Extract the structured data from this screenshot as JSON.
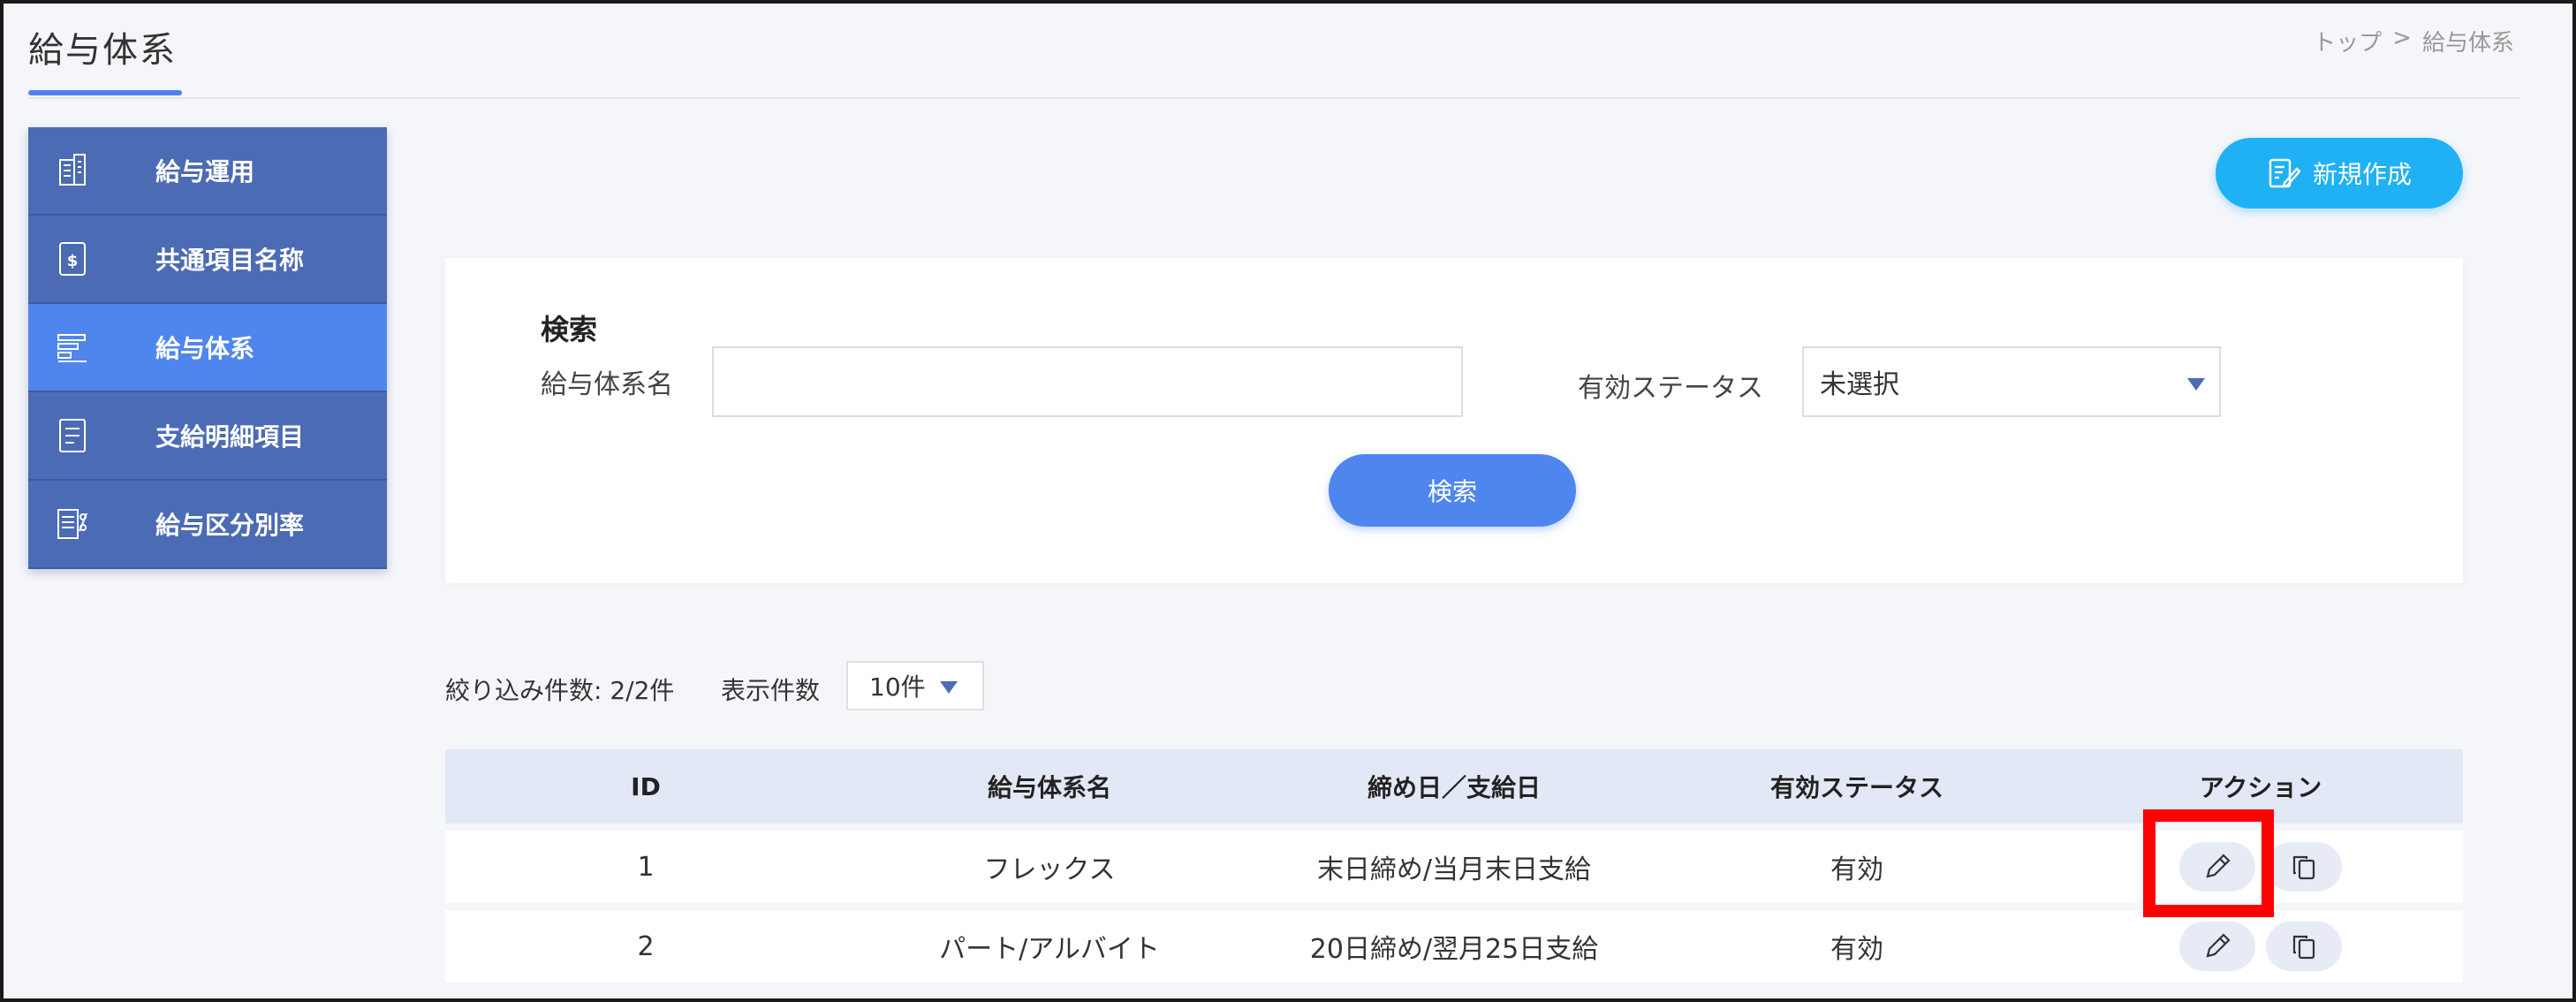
{
  "header": {
    "title": "給与体系",
    "breadcrumb": [
      "トップ",
      ">",
      "給与体系"
    ]
  },
  "sidebar": {
    "items": [
      {
        "label": "給与運用",
        "icon": "building-doc-icon",
        "active": false
      },
      {
        "label": "共通項目名称",
        "icon": "money-doc-icon",
        "active": false
      },
      {
        "label": "給与体系",
        "icon": "structure-icon",
        "active": true
      },
      {
        "label": "支給明細項目",
        "icon": "list-doc-icon",
        "active": false
      },
      {
        "label": "給与区分別率",
        "icon": "ratio-doc-icon",
        "active": false
      }
    ]
  },
  "toolbar": {
    "new_label": "新規作成"
  },
  "search": {
    "heading": "検索",
    "name_label": "給与体系名",
    "name_value": "",
    "status_label": "有効ステータス",
    "status_value": "未選択",
    "button_label": "検索"
  },
  "list": {
    "filtered_count": "絞り込み件数: 2/2件",
    "per_page_label": "表示件数",
    "per_page_value": "10件"
  },
  "table": {
    "headers": [
      "ID",
      "給与体系名",
      "締め日／支給日",
      "有効ステータス",
      "アクション"
    ],
    "rows": [
      {
        "id": "1",
        "name": "フレックス",
        "dates": "末日締め/当月末日支給",
        "status": "有効"
      },
      {
        "id": "2",
        "name": "パート/アルバイト",
        "dates": "20日締め/翌月25日支給",
        "status": "有効"
      }
    ]
  },
  "colors": {
    "sidebar": "#4c6bb5",
    "sidebar_active": "#4f86ee",
    "new_button": "#1fb1f4",
    "search_button": "#4f86ee",
    "highlight": "#ff0000"
  }
}
